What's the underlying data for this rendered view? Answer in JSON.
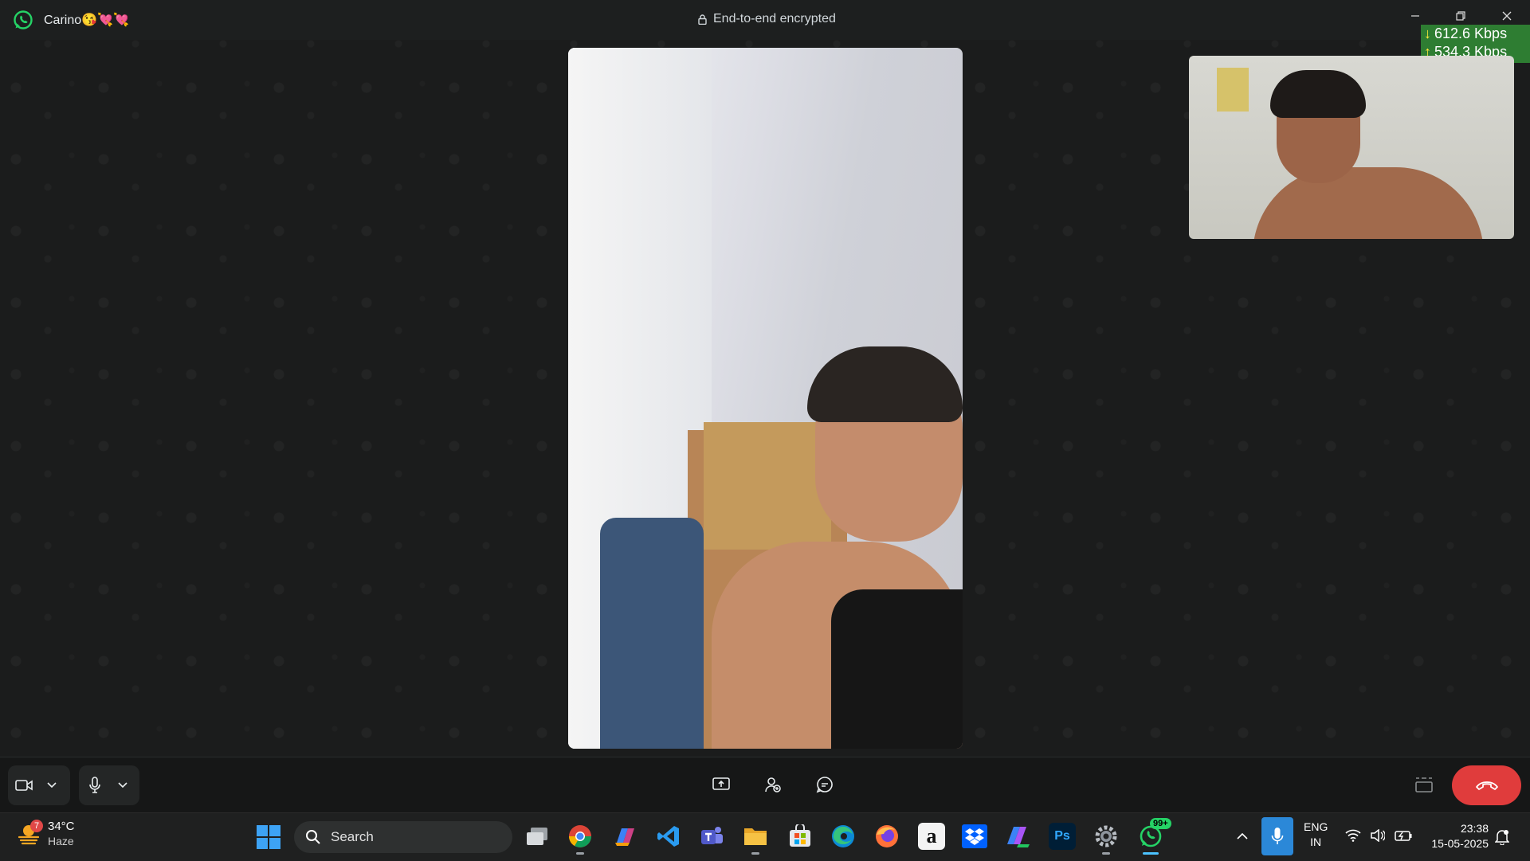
{
  "window": {
    "contact_name": "Carino😘💘💘",
    "encryption_label": "End-to-end encrypted"
  },
  "network_meter": {
    "download": "612.6 Kbps",
    "upload": "534.3 Kbps"
  },
  "taskbar": {
    "weather": {
      "badge": "7",
      "temperature": "34°C",
      "condition": "Haze"
    },
    "search_placeholder": "Search",
    "whatsapp_badge": "99+",
    "language_line1": "ENG",
    "language_line2": "IN",
    "time": "23:38",
    "date": "15-05-2025",
    "apps": [
      {
        "name": "task-view",
        "glyph": ""
      },
      {
        "name": "chrome",
        "glyph": ""
      },
      {
        "name": "copilot",
        "glyph": ""
      },
      {
        "name": "vscode",
        "glyph": ""
      },
      {
        "name": "teams",
        "glyph": ""
      },
      {
        "name": "file-explorer",
        "glyph": ""
      },
      {
        "name": "microsoft-store",
        "glyph": ""
      },
      {
        "name": "edge",
        "glyph": ""
      },
      {
        "name": "firefox",
        "glyph": ""
      },
      {
        "name": "amazon",
        "glyph": "a"
      },
      {
        "name": "dropbox",
        "glyph": ""
      },
      {
        "name": "microsoft-365",
        "glyph": ""
      },
      {
        "name": "photoshop",
        "glyph": "Ps"
      },
      {
        "name": "settings",
        "glyph": ""
      },
      {
        "name": "whatsapp",
        "glyph": ""
      }
    ]
  },
  "colors": {
    "accent_green": "#25d366",
    "end_call_red": "#e03c3c",
    "meter_bg": "#2e7d32",
    "taskbar_active": "#4cc2ff"
  }
}
